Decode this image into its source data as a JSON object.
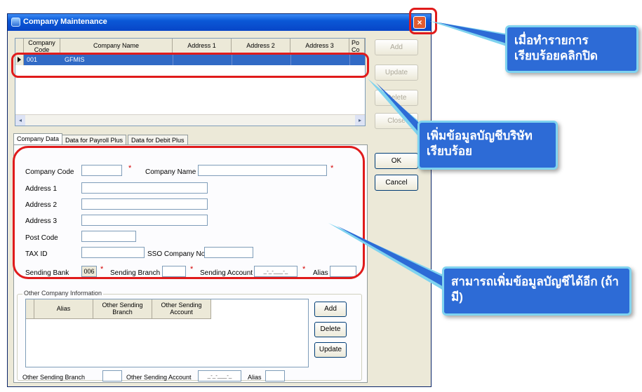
{
  "window": {
    "title": "Company Maintenance",
    "close_glyph": "×"
  },
  "grid": {
    "columns": [
      "Company Code",
      "Company Name",
      "Address 1",
      "Address 2",
      "Address 3",
      "Po Co"
    ],
    "rows": [
      {
        "code": "001",
        "name": "GFMIS",
        "addr1": "",
        "addr2": "",
        "addr3": ""
      }
    ]
  },
  "side_buttons": {
    "add": "Add",
    "update": "Update",
    "delete": "Delete",
    "close": "Close",
    "ok": "OK",
    "cancel": "Cancel"
  },
  "tabs": [
    "Company Data",
    "Data for Payroll Plus",
    "Data for Debit Plus"
  ],
  "form": {
    "company_code": "Company Code",
    "company_name": "Company Name",
    "address1": "Address 1",
    "address2": "Address 2",
    "address3": "Address 3",
    "post_code": "Post Code",
    "tax_id": "TAX ID",
    "sso_company_no": "SSO Company No.",
    "sending_bank": "Sending Bank",
    "sending_bank_value": "006",
    "sending_branch": "Sending Branch",
    "sending_account": "Sending Account",
    "sending_account_mask": "_-_-___-_",
    "alias": "Alias",
    "required_mark": "*"
  },
  "other": {
    "group_title": "Other Company Information",
    "columns": [
      "Alias",
      "Other Sending Branch",
      "Other Sending Account"
    ],
    "add": "Add",
    "delete": "Delete",
    "update": "Update",
    "other_sending_branch": "Other Sending Branch",
    "other_sending_account": "Other Sending Account",
    "account_mask": "_-_-___-_",
    "alias": "Alias"
  },
  "callouts": {
    "close_note": "เมื่อทำรายการเรียบร้อยคลิกปิด",
    "added_note": "เพิ่มข้อมูลบัญชีบริษัทเรียบร้อย",
    "more_note": "สามารถเพิ่มข้อมูลบัญชีได้อีก (ถ้ามี)"
  },
  "colors": {
    "accent_red": "#e01b1b",
    "callout_blue": "#2d6bd6",
    "callout_border": "#7fd3ef",
    "titlebar_blue": "#0a58d6",
    "selection_blue": "#316ac5"
  }
}
